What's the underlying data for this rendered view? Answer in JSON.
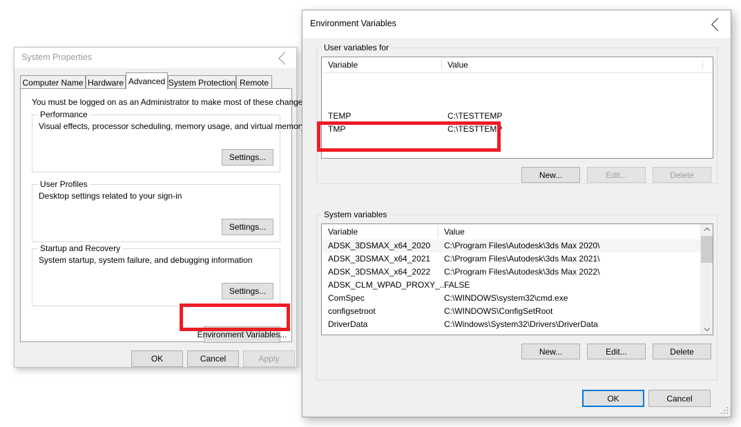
{
  "system_properties": {
    "title": "System Properties",
    "close_icon": "close-icon",
    "tabs": [
      {
        "label": "Computer Name",
        "selected": false
      },
      {
        "label": "Hardware",
        "selected": false
      },
      {
        "label": "Advanced",
        "selected": true
      },
      {
        "label": "System Protection",
        "selected": false
      },
      {
        "label": "Remote",
        "selected": false
      }
    ],
    "admin_notice": "You must be logged on as an Administrator to make most of these changes.",
    "groups": [
      {
        "label": "Performance",
        "description": "Visual effects, processor scheduling, memory usage, and virtual memory",
        "button": "Settings..."
      },
      {
        "label": "User Profiles",
        "description": "Desktop settings related to your sign-in",
        "button": "Settings..."
      },
      {
        "label": "Startup and Recovery",
        "description": "System startup, system failure, and debugging information",
        "button": "Settings..."
      }
    ],
    "environment_variables_button": "Environment Variables...",
    "footer": {
      "ok": "OK",
      "cancel": "Cancel",
      "apply": "Apply",
      "apply_disabled": true
    }
  },
  "environment_variables": {
    "title": "Environment Variables",
    "close_icon": "close-icon",
    "user_section": {
      "label": "User variables for ",
      "columns": [
        "Variable",
        "Value"
      ],
      "rows": [
        {
          "variable": "TEMP",
          "value": "C:\\TESTTEMP"
        },
        {
          "variable": "TMP",
          "value": "C:\\TESTTEMP"
        }
      ],
      "buttons": {
        "new": "New...",
        "edit": "Edit...",
        "delete": "Delete"
      },
      "edit_disabled": true,
      "delete_disabled": true
    },
    "system_section": {
      "label": "System variables",
      "columns": [
        "Variable",
        "Value"
      ],
      "rows": [
        {
          "variable": "ADSK_3DSMAX_x64_2020",
          "value": "C:\\Program Files\\Autodesk\\3ds Max 2020\\"
        },
        {
          "variable": "ADSK_3DSMAX_x64_2021",
          "value": "C:\\Program Files\\Autodesk\\3ds Max 2021\\"
        },
        {
          "variable": "ADSK_3DSMAX_x64_2022",
          "value": "C:\\Program Files\\Autodesk\\3ds Max 2022\\"
        },
        {
          "variable": "ADSK_CLM_WPAD_PROXY_...",
          "value": "FALSE"
        },
        {
          "variable": "ComSpec",
          "value": "C:\\WINDOWS\\system32\\cmd.exe"
        },
        {
          "variable": "configsetroot",
          "value": "C:\\WINDOWS\\ConfigSetRoot"
        },
        {
          "variable": "DriverData",
          "value": "C:\\Windows\\System32\\Drivers\\DriverData"
        }
      ],
      "buttons": {
        "new": "New...",
        "edit": "Edit...",
        "delete": "Delete"
      },
      "scrollbar": {
        "up_icon": "chevron-up-icon",
        "down_icon": "chevron-down-icon"
      }
    },
    "footer": {
      "ok": "OK",
      "cancel": "Cancel"
    }
  },
  "annotations": {
    "color": "#ee1c25",
    "boxes": [
      "user-variables-temp-tmp-highlight",
      "environment-variables-button-highlight"
    ]
  }
}
